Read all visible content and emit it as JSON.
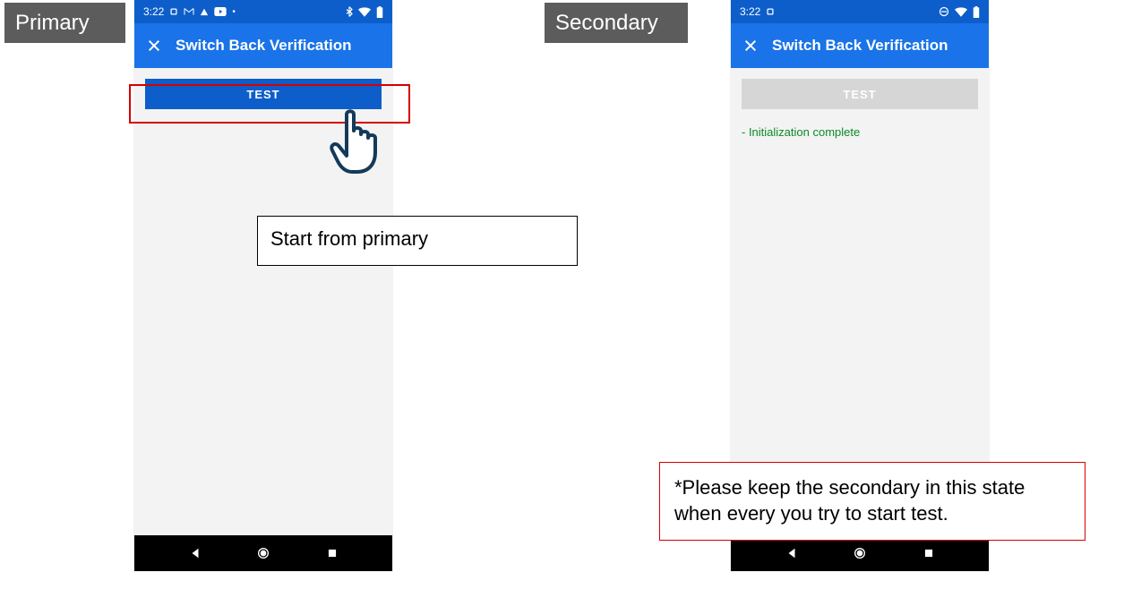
{
  "tags": {
    "primary": "Primary",
    "secondary": "Secondary"
  },
  "primary": {
    "statusbar": {
      "time": "3:22"
    },
    "appbar": {
      "title": "Switch Back Verification"
    },
    "button": {
      "label": "TEST"
    },
    "callout": "Start from primary"
  },
  "secondary": {
    "statusbar": {
      "time": "3:22"
    },
    "appbar": {
      "title": "Switch Back Verification"
    },
    "button": {
      "label": "TEST"
    },
    "status_msg": "- Initialization complete",
    "callout": "*Please keep the secondary in this state when every you try to start test."
  }
}
